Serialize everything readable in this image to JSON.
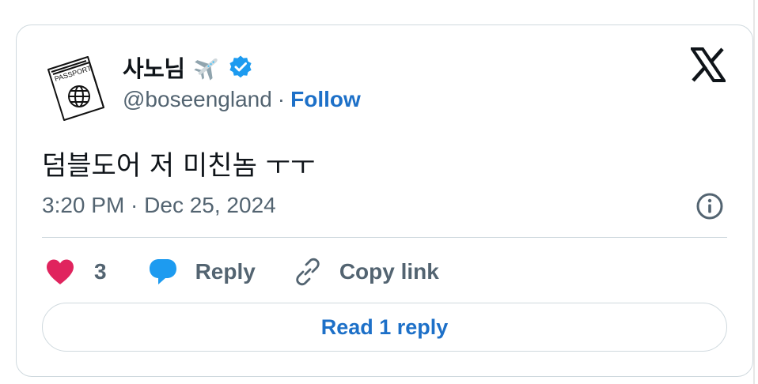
{
  "author": {
    "display_name": "사노님",
    "handle": "@boseengland",
    "follow_label": "Follow",
    "avatar_icon": "passport-icon",
    "avatar_text": "PASSPORT",
    "name_emoji_icon": "airplane-icon",
    "verified_icon": "verified-badge-icon"
  },
  "tweet": {
    "text": "덤블도어 저 미친놈 ㅜㅜ",
    "timestamp": "3:20 PM · Dec 25, 2024"
  },
  "actions": {
    "like_count": "3",
    "reply_label": "Reply",
    "copy_link_label": "Copy link"
  },
  "read_replies_label": "Read 1 reply",
  "brand_logo": "x-logo-icon",
  "colors": {
    "accent": "#1d70c8",
    "like": "#e0245e",
    "reply_icon": "#1d9bf0",
    "secondary_text": "#536471",
    "border": "#cfd9de",
    "verified": "#1d9bf0"
  }
}
